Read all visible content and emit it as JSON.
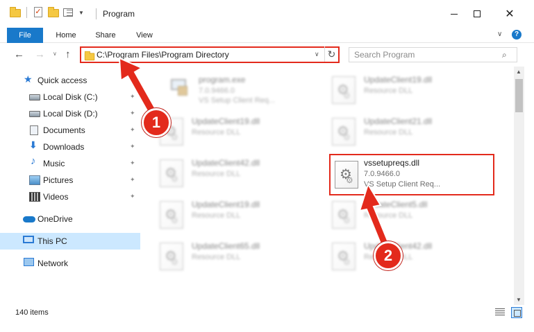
{
  "window": {
    "title": "Program",
    "minimize_icon": "minimize-icon",
    "maximize_icon": "maximize-icon",
    "close_glyph": "✕"
  },
  "ribbon": {
    "tabs": [
      "File",
      "Home",
      "Share",
      "View"
    ],
    "expand_glyph": "∨",
    "help_glyph": "?"
  },
  "nav": {
    "back_glyph": "←",
    "forward_glyph": "→",
    "recent_glyph": "∨",
    "up_glyph": "↑",
    "address": "C:\\Program Files\\Program Directory",
    "address_dropdown_glyph": "∨",
    "refresh_glyph": "↻",
    "search_placeholder": "Search Program",
    "search_glyph": "⌕"
  },
  "sidebar": {
    "items": [
      {
        "label": "Quick access",
        "icon": "star-icon"
      },
      {
        "label": "Local Disk (C:)",
        "icon": "drive-icon",
        "pinned": true
      },
      {
        "label": "Local Disk (D:)",
        "icon": "drive-icon",
        "pinned": true
      },
      {
        "label": "Documents",
        "icon": "documents-icon",
        "pinned": true
      },
      {
        "label": "Downloads",
        "icon": "download-icon",
        "pinned": true
      },
      {
        "label": "Music",
        "icon": "music-icon",
        "pinned": true
      },
      {
        "label": "Pictures",
        "icon": "pictures-icon",
        "pinned": true
      },
      {
        "label": "Videos",
        "icon": "videos-icon",
        "pinned": true
      },
      {
        "label": "OneDrive",
        "icon": "cloud-icon"
      },
      {
        "label": "This PC",
        "icon": "pc-icon",
        "selected": true
      },
      {
        "label": "Network",
        "icon": "network-icon"
      }
    ],
    "pin_glyph": "📌"
  },
  "files": [
    {
      "name": "program.exe",
      "version": "7.0.9466.0",
      "description": "VS Setup Client Req...",
      "type": "exe",
      "blurred": true
    },
    {
      "name": "UpdateClient19.dll",
      "version": "Resource DLL",
      "description": "",
      "type": "dll",
      "blurred": true
    },
    {
      "name": "UpdateClient19.dll",
      "version": "Resource DLL",
      "description": "",
      "type": "dll",
      "blurred": true
    },
    {
      "name": "UpdateClient21.dll",
      "version": "Resource DLL",
      "description": "",
      "type": "dll",
      "blurred": true
    },
    {
      "name": "UpdateClient42.dll",
      "version": "Resource DLL",
      "description": "",
      "type": "dll",
      "blurred": true
    },
    {
      "name": "vssetupreqs.dll",
      "version": "7.0.9466.0",
      "description": "VS Setup Client Req...",
      "type": "dll",
      "blurred": false,
      "highlighted": true
    },
    {
      "name": "UpdateClient19.dll",
      "version": "Resource DLL",
      "description": "",
      "type": "dll",
      "blurred": true
    },
    {
      "name": "UpdateClient5.dll",
      "version": "Resource DLL",
      "description": "",
      "type": "dll",
      "blurred": true
    },
    {
      "name": "UpdateClient65.dll",
      "version": "Resource DLL",
      "description": "",
      "type": "dll",
      "blurred": true
    },
    {
      "name": "UpdateClient42.dll",
      "version": "Resource DLL",
      "description": "",
      "type": "dll",
      "blurred": true
    }
  ],
  "status": {
    "item_count": "140 items"
  },
  "annotations": {
    "step1": "1",
    "step2": "2",
    "accent_color": "#e32a1c"
  },
  "colors": {
    "file_tab": "#1979ca",
    "selection": "#cce8ff",
    "highlight": "#e32a1c"
  }
}
